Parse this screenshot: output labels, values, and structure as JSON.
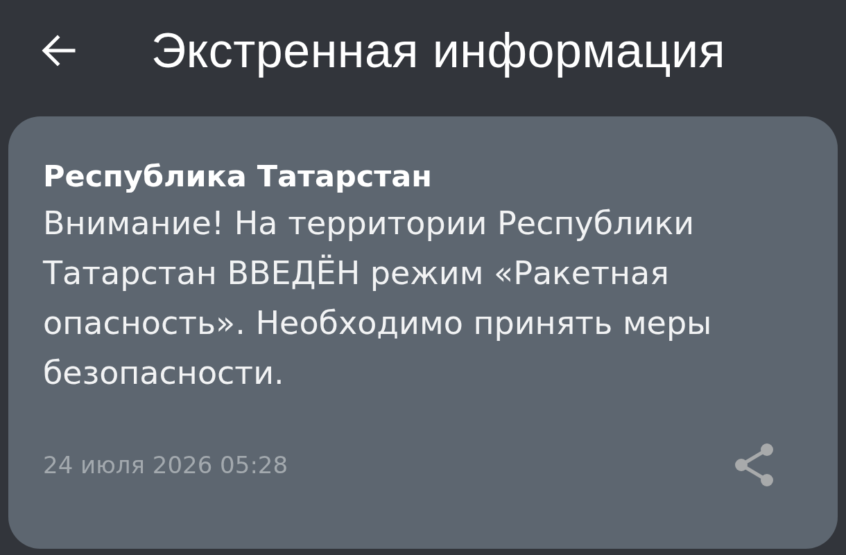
{
  "header": {
    "title": "Экстренная информация"
  },
  "alert": {
    "region": "Республика Татарстан",
    "message": "Внимание! На территории Республики Татарстан ВВЕДЁН режим «Ракетная опасность». Необходимо принять меры безопасности.",
    "date": "24 июля 2026 05:28"
  }
}
